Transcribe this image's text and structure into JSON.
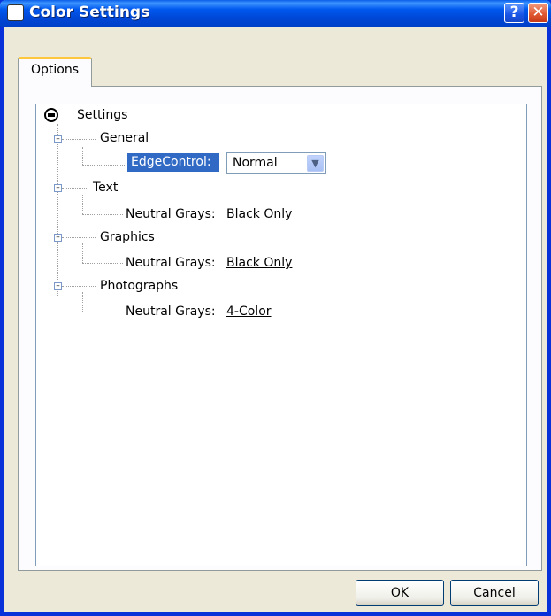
{
  "window": {
    "title": "Color Settings",
    "help_label": "?",
    "close_label": "✕"
  },
  "tabs": [
    {
      "label": "Options"
    }
  ],
  "tree": {
    "root": "Settings",
    "general": {
      "label": "General",
      "edge_control_label": "EdgeControl:",
      "edge_control_value": "Normal"
    },
    "text": {
      "label": "Text",
      "neutral_grays_label": "Neutral Grays:",
      "neutral_grays_value": "Black Only"
    },
    "graphics": {
      "label": "Graphics",
      "neutral_grays_label": "Neutral Grays:",
      "neutral_grays_value": "Black Only"
    },
    "photographs": {
      "label": "Photographs",
      "neutral_grays_label": "Neutral Grays:",
      "neutral_grays_value": "4-Color"
    }
  },
  "buttons": {
    "ok": "OK",
    "cancel": "Cancel"
  },
  "icons": {
    "app": "hp-logo-icon",
    "tree_root": "hp-logo-icon",
    "expander": "collapse-minus-icon",
    "dropdown": "chevron-down-icon"
  },
  "colors": {
    "titlebar": "#0058ee",
    "selection": "#316ac5",
    "tab_accent": "#ffc83c",
    "close_button": "#e25a33"
  }
}
